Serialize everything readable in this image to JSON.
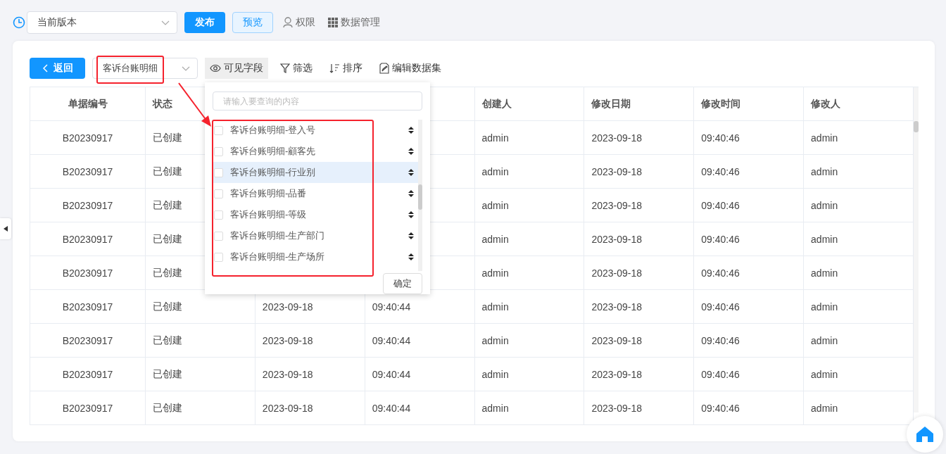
{
  "top_bar": {
    "version_select": {
      "value": "当前版本"
    },
    "buttons": [
      {
        "label": "发布",
        "kind": "primary"
      },
      {
        "label": "预览",
        "kind": "light"
      }
    ],
    "links": [
      {
        "label": "权限",
        "kind": "user"
      },
      {
        "label": "数据管理",
        "kind": "grid"
      }
    ]
  },
  "toolbar": {
    "back_button": {
      "label": "返回"
    },
    "dataset_select": {
      "value": "客诉台账明细"
    },
    "tools": [
      {
        "label": "可见字段",
        "kind": "eye",
        "selected": true
      },
      {
        "label": "筛选",
        "kind": "filter",
        "selected": false
      },
      {
        "label": "排序",
        "kind": "sort",
        "selected": false
      },
      {
        "label": "编辑数据集",
        "kind": "edit",
        "selected": false
      }
    ]
  },
  "table": {
    "columns": [
      "单据编号",
      "状态",
      null,
      null,
      "创建人",
      "修改日期",
      "修改时间",
      "修改人"
    ],
    "rows": [
      {
        "cells": [
          "B20230917",
          "已创建",
          null,
          null,
          "admin",
          "2023-09-18",
          "09:40:46",
          "admin"
        ]
      },
      {
        "cells": [
          "B20230917",
          "已创建",
          null,
          null,
          "admin",
          "2023-09-18",
          "09:40:46",
          "admin"
        ]
      },
      {
        "cells": [
          "B20230917",
          "已创建",
          null,
          null,
          "admin",
          "2023-09-18",
          "09:40:46",
          "admin"
        ]
      },
      {
        "cells": [
          "B20230917",
          "已创建",
          null,
          null,
          "admin",
          "2023-09-18",
          "09:40:46",
          "admin"
        ]
      },
      {
        "cells": [
          "B20230917",
          "已创建",
          null,
          null,
          "admin",
          "2023-09-18",
          "09:40:46",
          "admin"
        ]
      },
      {
        "cells": [
          "B20230917",
          "已创建",
          "2023-09-18",
          "09:40:44",
          "admin",
          "2023-09-18",
          "09:40:46",
          "admin"
        ]
      },
      {
        "cells": [
          "B20230917",
          "已创建",
          "2023-09-18",
          "09:40:44",
          "admin",
          "2023-09-18",
          "09:40:46",
          "admin"
        ]
      },
      {
        "cells": [
          "B20230917",
          "已创建",
          "2023-09-18",
          "09:40:44",
          "admin",
          "2023-09-18",
          "09:40:46",
          "admin"
        ]
      },
      {
        "cells": [
          "B20230917",
          "已创建",
          "2023-09-18",
          "09:40:44",
          "admin",
          "2023-09-18",
          "09:40:46",
          "admin"
        ]
      }
    ]
  },
  "field_popup": {
    "search": {
      "placeholder": "请输入要查询的内容"
    },
    "fields": [
      {
        "label": "客诉台账明细-登入号",
        "checked": false,
        "selected": false
      },
      {
        "label": "客诉台账明细-顧客先",
        "checked": false,
        "selected": false
      },
      {
        "label": "客诉台账明细-行业别",
        "checked": false,
        "selected": true
      },
      {
        "label": "客诉台账明细-品番",
        "checked": false,
        "selected": false
      },
      {
        "label": "客诉台账明细-等级",
        "checked": false,
        "selected": false
      },
      {
        "label": "客诉台账明细-生产部门",
        "checked": false,
        "selected": false
      },
      {
        "label": "客诉台账明细-生产场所",
        "checked": false,
        "selected": false
      }
    ],
    "confirm_button": {
      "label": "确定"
    }
  }
}
